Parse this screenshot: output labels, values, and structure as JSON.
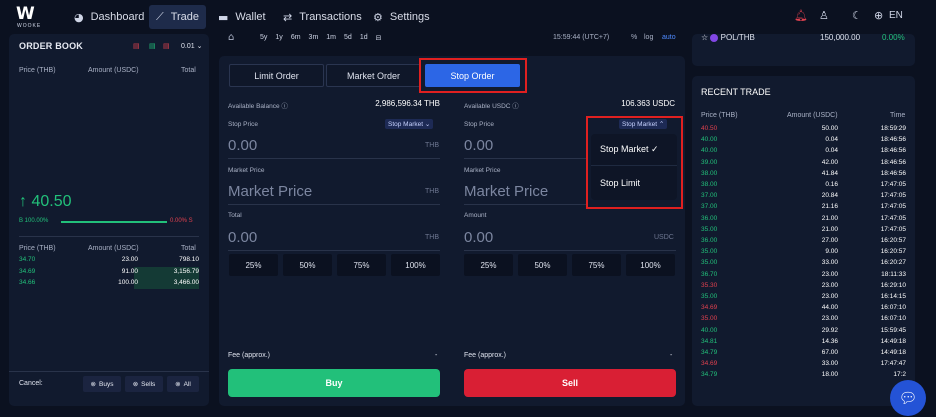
{
  "nav": {
    "logo_text": "WOOKE",
    "items": [
      {
        "label": "Dashboard",
        "icon": "dashboard-icon"
      },
      {
        "label": "Trade",
        "icon": "trade-chart-icon"
      },
      {
        "label": "Wallet",
        "icon": "wallet-icon"
      },
      {
        "label": "Transactions",
        "icon": "transactions-icon"
      },
      {
        "label": "Settings",
        "icon": "settings-icon"
      }
    ],
    "lang": "EN"
  },
  "orderbook": {
    "title": "ORDER BOOK",
    "precision": "0.01",
    "headers": {
      "price": "Price (THB)",
      "amount": "Amount (USDC)",
      "total": "Total"
    },
    "last_price": "40.50",
    "buy_ratio": "B 100.00%",
    "sell_ratio": "0.00% S",
    "bids": [
      {
        "price": "34.70",
        "amount": "23.00",
        "total": "798.10"
      },
      {
        "price": "34.69",
        "amount": "91.00",
        "total": "3,156.79"
      },
      {
        "price": "34.66",
        "amount": "100.00",
        "total": "3,466.00"
      }
    ],
    "footer": {
      "cancel": "Cancel:",
      "buys": "Buys",
      "sells": "Sells",
      "all": "All"
    }
  },
  "chartbar": {
    "ranges": [
      "5y",
      "1y",
      "6m",
      "3m",
      "1m",
      "5d",
      "1d"
    ],
    "time": "15:59:44 (UTC+7)",
    "pct": "%",
    "log": "log",
    "auto": "auto"
  },
  "order": {
    "tabs": [
      "Limit Order",
      "Market Order",
      "Stop Order"
    ],
    "buy": {
      "available_label": "Available Balance",
      "available_value": "2,986,596.34 THB",
      "stop_price_label": "Stop Price",
      "stop_dropdown": "Stop Market",
      "stop_price_value": "0.00",
      "stop_price_unit": "THB",
      "market_price_label": "Market Price",
      "market_price_value": "Market Price",
      "market_price_unit": "THB",
      "total_label": "Total",
      "total_value": "0.00",
      "total_unit": "THB",
      "pcts": [
        "25%",
        "50%",
        "75%",
        "100%"
      ],
      "fee_label": "Fee (approx.)",
      "fee_value": "-",
      "button": "Buy"
    },
    "sell": {
      "available_label": "Available USDC",
      "available_value": "106.363 USDC",
      "stop_price_label": "Stop Price",
      "stop_dropdown": "Stop Market",
      "stop_price_value": "0.00",
      "market_price_label": "Market Price",
      "market_price_value": "Market Price",
      "amount_label": "Amount",
      "amount_value": "0.00",
      "amount_unit": "USDC",
      "pcts": [
        "25%",
        "50%",
        "75%",
        "100%"
      ],
      "fee_label": "Fee (approx.)",
      "fee_value": "-",
      "button": "Sell"
    },
    "dropdown_menu": {
      "option1": "Stop Market",
      "option2": "Stop Limit",
      "selected": "Stop Market"
    }
  },
  "market": {
    "pair": "POL/THB",
    "price": "150,000.00",
    "change": "0.00%"
  },
  "recent": {
    "title": "RECENT TRADE",
    "headers": {
      "price": "Price (THB)",
      "amount": "Amount (USDC)",
      "time": "Time"
    },
    "rows": [
      {
        "p": "40.50",
        "a": "50.00",
        "t": "18:59:29",
        "side": "sell"
      },
      {
        "p": "40.00",
        "a": "0.04",
        "t": "18:46:56",
        "side": "buy"
      },
      {
        "p": "40.00",
        "a": "0.04",
        "t": "18:46:56",
        "side": "buy"
      },
      {
        "p": "39.00",
        "a": "42.00",
        "t": "18:46:56",
        "side": "buy"
      },
      {
        "p": "38.00",
        "a": "41.84",
        "t": "18:46:56",
        "side": "buy"
      },
      {
        "p": "38.00",
        "a": "0.16",
        "t": "17:47:05",
        "side": "buy"
      },
      {
        "p": "37.00",
        "a": "20.84",
        "t": "17:47:05",
        "side": "buy"
      },
      {
        "p": "37.00",
        "a": "21.16",
        "t": "17:47:05",
        "side": "buy"
      },
      {
        "p": "36.00",
        "a": "21.00",
        "t": "17:47:05",
        "side": "buy"
      },
      {
        "p": "35.00",
        "a": "21.00",
        "t": "17:47:05",
        "side": "buy"
      },
      {
        "p": "36.00",
        "a": "27.00",
        "t": "16:20:57",
        "side": "buy"
      },
      {
        "p": "35.00",
        "a": "9.00",
        "t": "16:20:57",
        "side": "buy"
      },
      {
        "p": "35.00",
        "a": "33.00",
        "t": "16:20:27",
        "side": "buy"
      },
      {
        "p": "36.70",
        "a": "23.00",
        "t": "18:11:33",
        "side": "buy"
      },
      {
        "p": "35.30",
        "a": "23.00",
        "t": "16:29:10",
        "side": "sell"
      },
      {
        "p": "35.00",
        "a": "23.00",
        "t": "16:14:15",
        "side": "buy"
      },
      {
        "p": "34.69",
        "a": "44.00",
        "t": "16:07:10",
        "side": "sell"
      },
      {
        "p": "35.00",
        "a": "23.00",
        "t": "16:07:10",
        "side": "sell"
      },
      {
        "p": "40.00",
        "a": "29.92",
        "t": "15:59:45",
        "side": "buy"
      },
      {
        "p": "34.81",
        "a": "14.36",
        "t": "14:49:18",
        "side": "buy"
      },
      {
        "p": "34.79",
        "a": "67.00",
        "t": "14:49:18",
        "side": "buy"
      },
      {
        "p": "34.69",
        "a": "33.00",
        "t": "17:47:47",
        "side": "sell"
      },
      {
        "p": "34.79",
        "a": "18.00",
        "t": "17:2",
        "side": "buy"
      }
    ]
  }
}
